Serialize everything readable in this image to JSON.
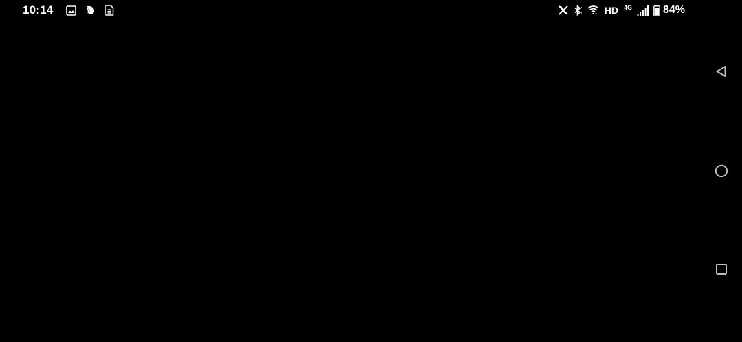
{
  "status_bar": {
    "time": "10:14",
    "hd_label": "HD",
    "network_type": "4G",
    "battery_percent": "84%",
    "notification_icons": [
      "image-icon",
      "app-leaf-icon",
      "document-icon"
    ],
    "system_icons": [
      "x-icon",
      "bluetooth-icon",
      "wifi-icon",
      "signal-icon",
      "battery-icon"
    ]
  },
  "navigation": {
    "buttons": [
      "back",
      "home",
      "recents"
    ]
  },
  "colors": {
    "background": "#000000",
    "foreground": "#ffffff",
    "nav_icon": "#bdbdbd"
  }
}
